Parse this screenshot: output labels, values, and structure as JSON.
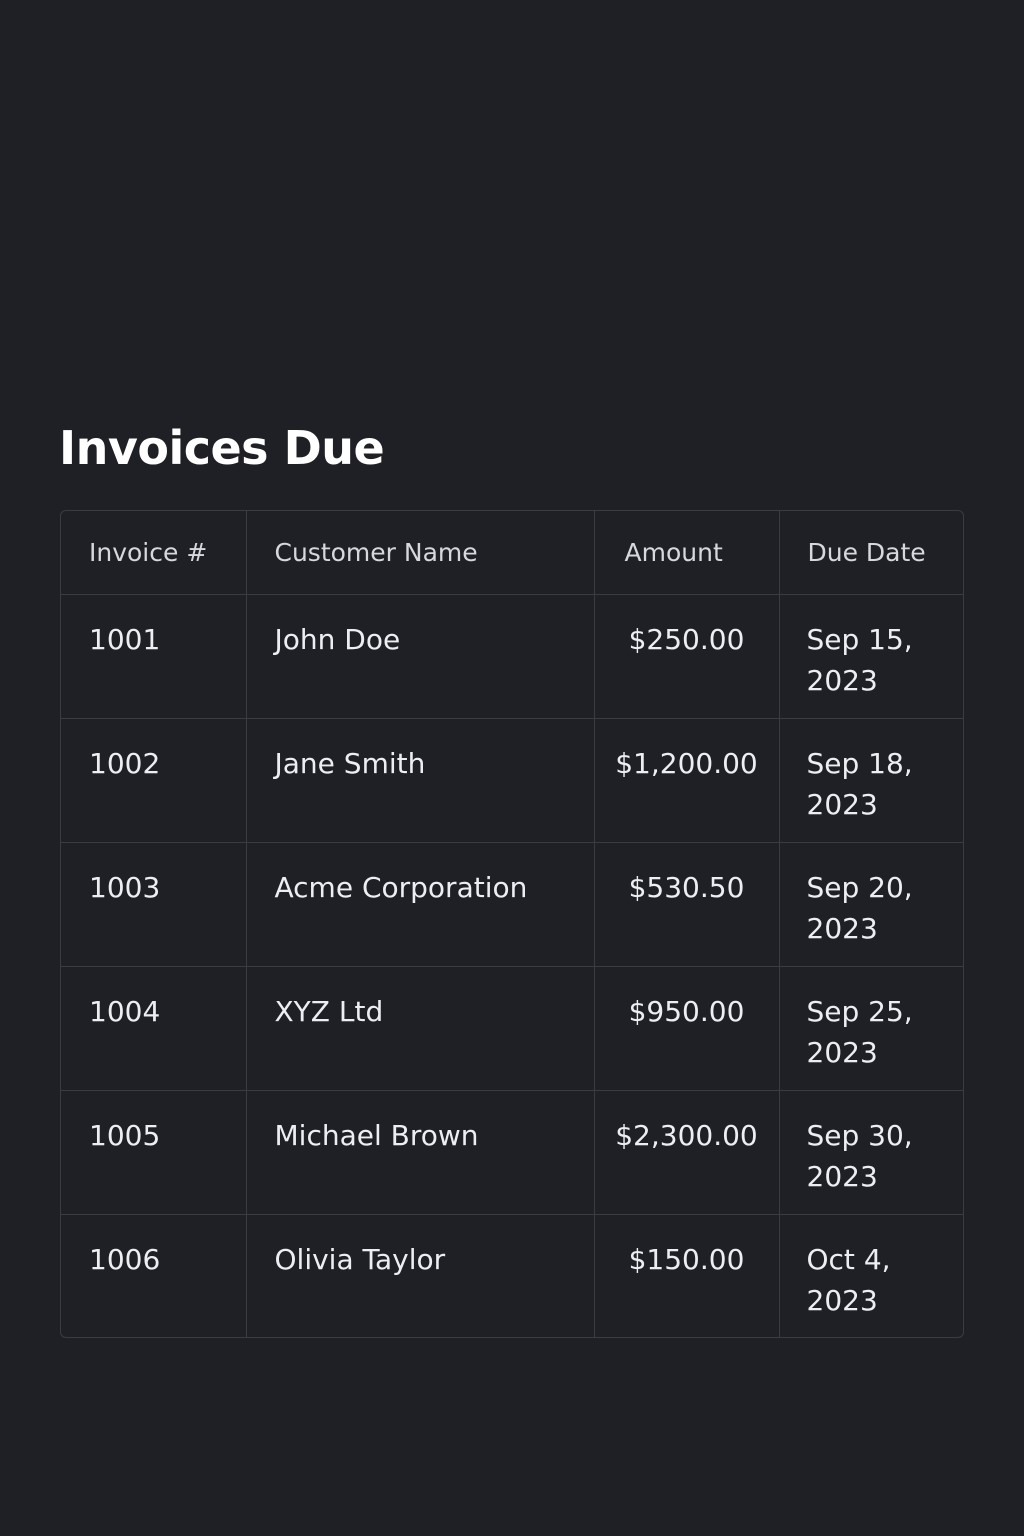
{
  "page": {
    "title": "Invoices Due"
  },
  "table": {
    "headers": [
      "Invoice #",
      "Customer Name",
      "Amount",
      "Due Date"
    ],
    "rows": [
      {
        "invoice": "1001",
        "customer": "John Doe",
        "amount": "$250.00",
        "due": "Sep 15, 2023"
      },
      {
        "invoice": "1002",
        "customer": "Jane Smith",
        "amount": "$1,200.00",
        "due": "Sep 18, 2023"
      },
      {
        "invoice": "1003",
        "customer": "Acme Corporation",
        "amount": "$530.50",
        "due": "Sep 20, 2023"
      },
      {
        "invoice": "1004",
        "customer": "XYZ Ltd",
        "amount": "$950.00",
        "due": "Sep 25, 2023"
      },
      {
        "invoice": "1005",
        "customer": "Michael Brown",
        "amount": "$2,300.00",
        "due": "Sep 30, 2023"
      },
      {
        "invoice": "1006",
        "customer": "Olivia Taylor",
        "amount": "$150.00",
        "due": "Oct 4, 2023"
      }
    ]
  },
  "colors": {
    "background": "#1f2025",
    "border": "#3a3c42",
    "title": "#ffffff",
    "header_text": "#d6d8dd",
    "cell_text": "#eceef1"
  }
}
